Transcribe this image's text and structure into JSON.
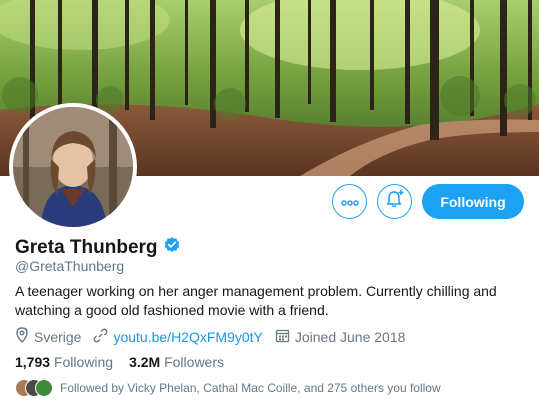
{
  "profile": {
    "name": "Greta Thunberg",
    "handle": "@GretaThunberg",
    "verified": true,
    "bio": "A teenager working on her anger management problem. Currently chilling and watching a good old fashioned movie with a friend.",
    "location": "Sverige",
    "website": "youtu.be/H2QxFM9y0tY",
    "joined": "Joined June 2018"
  },
  "stats": {
    "following_count": "1,793",
    "following_label": "Following",
    "followers_count": "3.2M",
    "followers_label": "Followers"
  },
  "actions": {
    "more_icon": "more-icon",
    "notify_icon": "bell-plus-icon",
    "follow_label": "Following"
  },
  "followed_by": {
    "text": "Followed by Vicky Phelan, Cathal Mac Coille, and 275 others you follow"
  },
  "colors": {
    "accent": "#1da1f2",
    "link": "#1b95e0",
    "secondary_text": "#657786",
    "verified": "#1da1f2"
  }
}
